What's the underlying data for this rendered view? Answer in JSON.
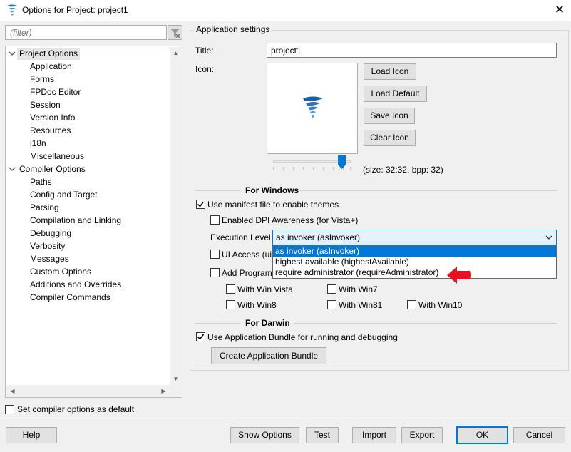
{
  "window": {
    "title": "Options for Project: project1",
    "close_glyph": "✕"
  },
  "filter": {
    "placeholder": "(filter)"
  },
  "tree": {
    "items": [
      {
        "label": "Project Options",
        "level": 1,
        "expanded": true,
        "selected": true
      },
      {
        "label": "Application",
        "level": 2
      },
      {
        "label": "Forms",
        "level": 2
      },
      {
        "label": "FPDoc Editor",
        "level": 2
      },
      {
        "label": "Session",
        "level": 2
      },
      {
        "label": "Version Info",
        "level": 2
      },
      {
        "label": "Resources",
        "level": 2
      },
      {
        "label": "i18n",
        "level": 2
      },
      {
        "label": "Miscellaneous",
        "level": 2
      },
      {
        "label": "Compiler Options",
        "level": 1,
        "expanded": true
      },
      {
        "label": "Paths",
        "level": 2
      },
      {
        "label": "Config and Target",
        "level": 2
      },
      {
        "label": "Parsing",
        "level": 2
      },
      {
        "label": "Compilation and Linking",
        "level": 2
      },
      {
        "label": "Debugging",
        "level": 2
      },
      {
        "label": "Verbosity",
        "level": 2
      },
      {
        "label": "Messages",
        "level": 2
      },
      {
        "label": "Custom Options",
        "level": 2
      },
      {
        "label": "Additions and Overrides",
        "level": 2
      },
      {
        "label": "Compiler Commands",
        "level": 2
      }
    ]
  },
  "set_default": {
    "label": "Set compiler options as default",
    "checked": false
  },
  "app_settings": {
    "group_title": "Application settings",
    "title_label": "Title:",
    "title_value": "project1",
    "icon_label": "Icon:",
    "buttons": {
      "load_icon": "Load Icon",
      "load_default": "Load Default",
      "save_icon": "Save Icon",
      "clear_icon": "Clear Icon"
    },
    "size_info": "(size: 32:32, bpp: 32)",
    "slider_value": 0.92
  },
  "windows": {
    "section_title": "For Windows",
    "use_manifest": {
      "label": "Use manifest file to enable themes",
      "checked": true
    },
    "dpi_awareness": {
      "label": "Enabled DPI Awareness (for Vista+)",
      "checked": false
    },
    "execution_level": {
      "label": "Execution Level",
      "selected": "as invoker (asInvoker)",
      "options": [
        "as invoker (asInvoker)",
        "highest available (highestAvailable)",
        "require administrator (requireAdministrator)"
      ]
    },
    "ui_access": {
      "label": "UI Access (uiA",
      "checked": false
    },
    "add_program": {
      "label": "Add Program",
      "checked": false
    },
    "os": {
      "win_vista": {
        "label": "With Win Vista",
        "checked": false
      },
      "win7": {
        "label": "With Win7",
        "checked": false
      },
      "win8": {
        "label": "With Win8",
        "checked": false
      },
      "win81": {
        "label": "With Win81",
        "checked": false
      },
      "win10": {
        "label": "With Win10",
        "checked": false
      }
    }
  },
  "darwin": {
    "section_title": "For Darwin",
    "use_bundle": {
      "label": "Use Application Bundle for running and debugging",
      "checked": true
    },
    "create_bundle": "Create Application Bundle"
  },
  "footer": {
    "help": "Help",
    "show_options": "Show Options",
    "test": "Test",
    "import": "Import",
    "export": "Export",
    "ok": "OK",
    "cancel": "Cancel"
  },
  "colors": {
    "accent": "#0078d7",
    "arrow": "#e81123",
    "icon_blue": "#1f6fb5"
  }
}
